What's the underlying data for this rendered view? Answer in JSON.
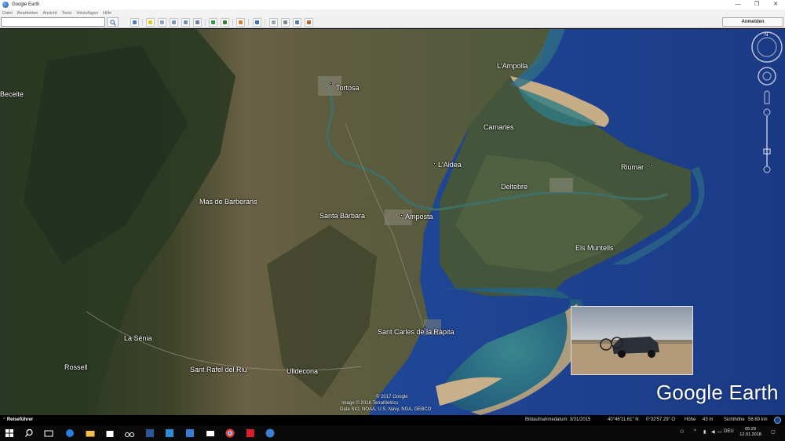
{
  "window": {
    "title": "Google Earth",
    "minimize": "—",
    "maximize": "❐",
    "close": "✕"
  },
  "menu": [
    "Datei",
    "Bearbeiten",
    "Ansicht",
    "Tools",
    "Hinzufügen",
    "Hilfe"
  ],
  "toolbar": {
    "search_value": "",
    "login_label": "Anmelden"
  },
  "map": {
    "labels": {
      "beceite": "Beceite",
      "tortosa": "Tortosa",
      "lampolla": "L'Ampolla",
      "camarles": "Camarles",
      "laldea": "L'Aldea",
      "riumar": "Riumar",
      "deltebre": "Deltebre",
      "mas_de_barberans": "Mas de Barberans",
      "santa_barbara": "Santa Bàrbara",
      "amposta": "Amposta",
      "els_muntells": "Els Muntells",
      "sant_carles": "Sant Carles de la Ràpita",
      "la_senia": "La Sénia",
      "rossell": "Rossell",
      "sant_rafel": "Sant Rafel del Riu",
      "ulldecona": "Ulldecona"
    },
    "logo": "Google Earth",
    "credits": [
      "© 2017 Google",
      "Image © 2018 TerraMetrics",
      "Data SIO, NOAA, U.S. Navy, NGA, GEBCO"
    ]
  },
  "status": {
    "tour_guide": "Reiseführer",
    "imagery_date": "Bildaufnahmedatum: 3/31/2015",
    "lat": "40°46'11.61\" N",
    "lon": "0°32'57.29\" O",
    "elev_label": "Höhe",
    "elev": "43 m",
    "eye_label": "Sichthöhe",
    "eye": "58.69 km"
  },
  "taskbar": {
    "language": "DEU",
    "time": "05:29",
    "date": "12.01.2018"
  },
  "colors": {
    "sea": "#1d3f85",
    "shallow": "#2f7a86",
    "land": "#5a5a3c",
    "mountains": "#2c3b25"
  }
}
